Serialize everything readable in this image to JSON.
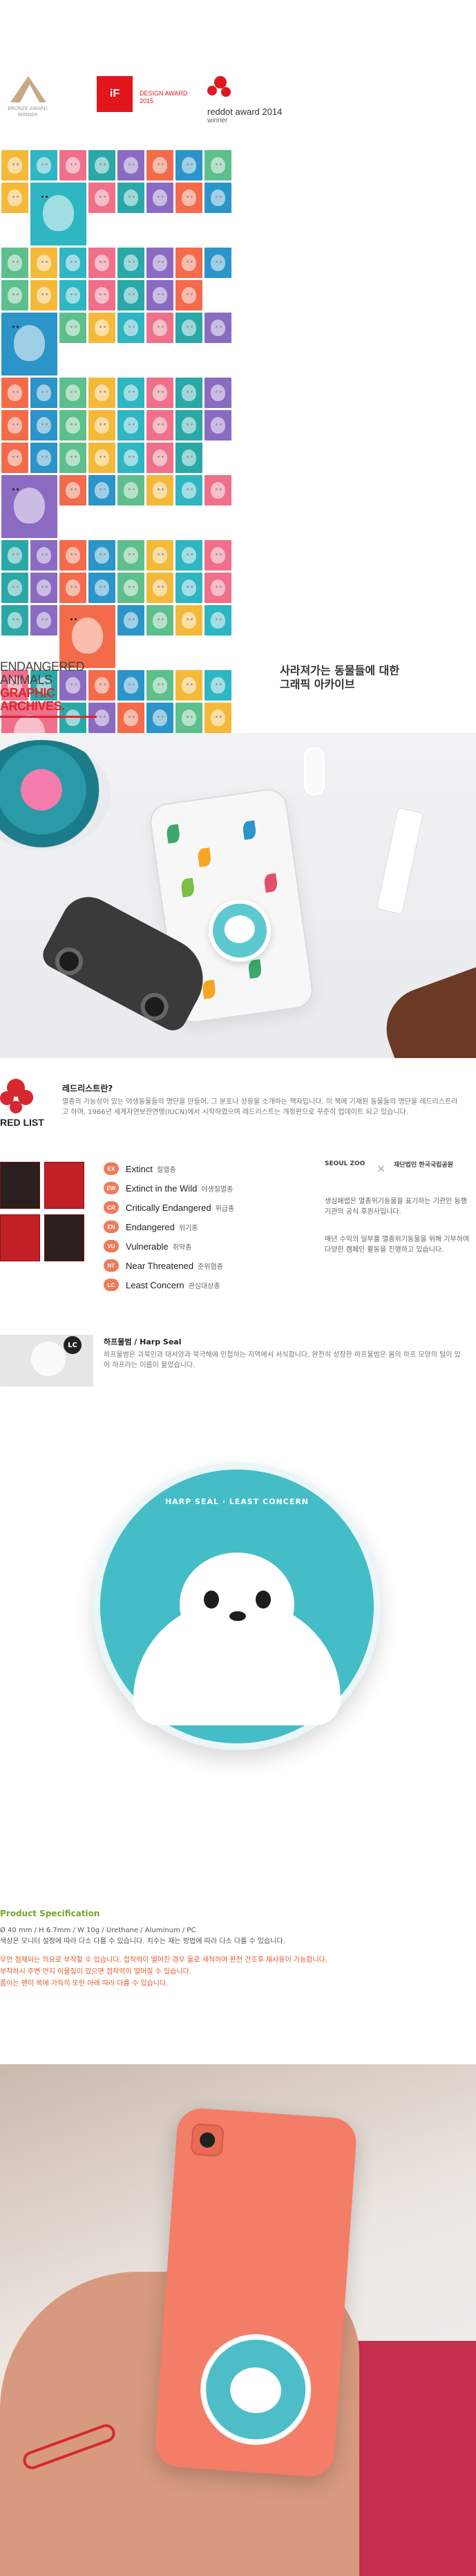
{
  "awards": [
    {
      "type": "bronze",
      "caption": "BRONZE AWARD WINNER"
    },
    {
      "type": "if",
      "logo": "iF",
      "caption": "DESIGN AWARD 2015"
    },
    {
      "type": "reddot",
      "caption": "reddot award 2014",
      "sub": "winner"
    }
  ],
  "colors": {
    "accent": "#d7282f",
    "teal": "#45bdc7",
    "green": "#7aa434",
    "warning": "#e25b2a"
  },
  "tiles": [
    "#2aa8a8",
    "#f06f8a",
    "#2fb6c3",
    "#f5b93a",
    "#5dbf8b",
    "#2b94c8",
    "#f36b4a",
    "#8b6ac2"
  ],
  "headline": {
    "left1": "ENDANGERED",
    "left2": "ANIMALS",
    "left3": "GRAPHIC",
    "left4": "ARCHIVES.",
    "right1": "사라져가는 동물들에 대한",
    "right2": "그래픽 아카이브"
  },
  "redlist": {
    "logo": "RED LIST",
    "title": "레드리스트란?",
    "desc": "멸종의 가능성이 있는 야생동물들의 명단을 만들어, 그 분포나 상황을 소개하는 책자입니다. 이 책에 기재된 동물들의 명단을 레드리스트라고 하며, 1966년 세계자연보전연맹(IUCN)에서 시작하였으며 레드리스트는 개정판으로 꾸준히 업데이트 되고 있습니다.",
    "categories": [
      {
        "badge": "EX",
        "en": "Extinct",
        "ko": "절멸종"
      },
      {
        "badge": "EW",
        "en": "Extinct in the Wild",
        "ko": "야생절멸종"
      },
      {
        "badge": "CR",
        "en": "Critically Endangered",
        "ko": "위급종"
      },
      {
        "badge": "EN",
        "en": "Endangered",
        "ko": "위기종"
      },
      {
        "badge": "VU",
        "en": "Vulnerable",
        "ko": "취약종"
      },
      {
        "badge": "NT",
        "en": "Near Threatened",
        "ko": "준위협종"
      },
      {
        "badge": "LC",
        "en": "Least Concern",
        "ko": "관심대상종"
      }
    ],
    "partner_left": "SEOUL ZOO",
    "partner_right": "재단법인 한국국립공원",
    "partner_desc1": "생심페랩은 멸종위기동물을 표기하는 기관인 동행기관의 공식 후원사입니다.",
    "partner_desc2": "매년 수익의 일부를 멸종위기동물을 위해 기부하며 다양한 캠페인 활동을 진행하고 있습니다."
  },
  "seal": {
    "badge": "LC",
    "name": "하프물범 / Harp Seal",
    "desc": "하프물범은 괴북인과 대서양과 북극해에 인접하는 지역에서 서식합니다. 완전히 성장한 하프물범은 몸의 하프 모양의 털이 있어 하프라는 이름이 붙었습니다.",
    "grip_label": "HARP SEAL · LEAST CONCERN"
  },
  "spec": {
    "title": "Product Specification",
    "line1": "Ø 40 mm / H 6.7mm / W 10g / Urethane / Aluminum / PC",
    "line2": "색상은 모니터 설정에 따라 다소 다를 수 있습니다. 치수는 재는 방법에 따라 다소 다를 수 있습니다.",
    "warn1": "무언 첨제되는 의요로 부착할 수 있습니다. 접착력이 떨어진 경우 물로 세척하여 완전 건조후 재사용이 가능합니다.",
    "warn2": "부착하시 주변 먼지 이물질이 있으면 접착력이 떨어질 수 있습니다.",
    "warn3": "품이는 팬이 목에 가득히 또한 아래 따라 다를 수 있습니다."
  }
}
